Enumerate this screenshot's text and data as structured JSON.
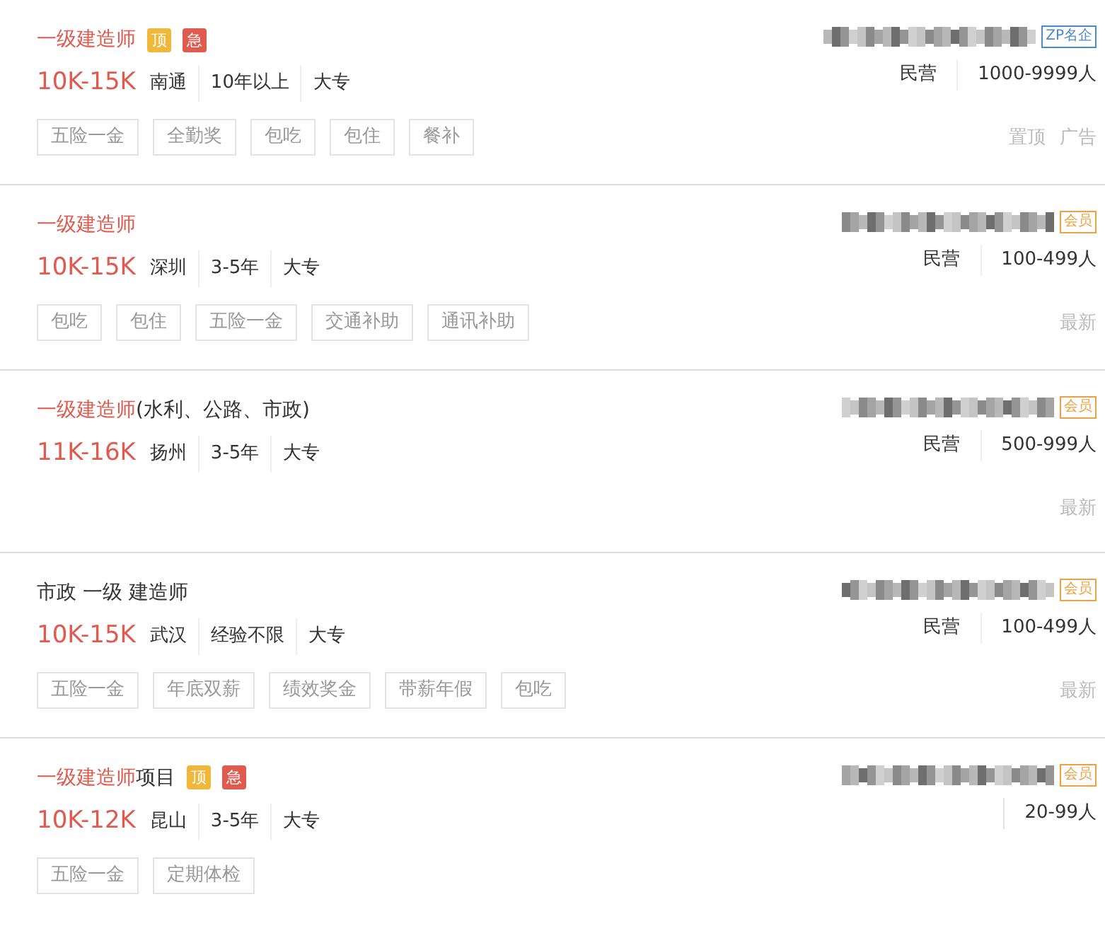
{
  "jobs": [
    {
      "title": [
        {
          "text": "一级建造师",
          "highlight": true
        }
      ],
      "flags": [
        {
          "text": "顶",
          "kind": "top"
        },
        {
          "text": "急",
          "kind": "urgent"
        }
      ],
      "salary": "10K-15K",
      "meta": [
        "南通",
        "10年以上",
        "大专"
      ],
      "tags": [
        "五险一金",
        "全勤奖",
        "包吃",
        "包住",
        "餐补"
      ],
      "company": {
        "blurred": true,
        "badge": {
          "text": "ZP名企",
          "color": "#4a8bd0"
        },
        "type": "民营",
        "size": "1000-9999人"
      },
      "labels": [
        "置顶",
        "广告"
      ]
    },
    {
      "title": [
        {
          "text": "一级建造师",
          "highlight": true
        }
      ],
      "salary": "10K-15K",
      "meta": [
        "深圳",
        "3-5年",
        "大专"
      ],
      "tags": [
        "包吃",
        "包住",
        "五险一金",
        "交通补助",
        "通讯补助"
      ],
      "company": {
        "blurred": true,
        "badge": {
          "text": "会员",
          "color": "#f0a040"
        },
        "type": "民营",
        "size": "100-499人"
      },
      "labels": [
        "最新"
      ]
    },
    {
      "title": [
        {
          "text": "一级建造师",
          "highlight": true
        },
        {
          "text": "(水利、公路、市政)",
          "highlight": false
        }
      ],
      "salary": "11K-16K",
      "meta": [
        "扬州",
        "3-5年",
        "大专"
      ],
      "company": {
        "blurred": true,
        "badge": {
          "text": "会员",
          "color": "#f0a040"
        },
        "type": "民营",
        "size": "500-999人"
      },
      "labels": [
        "最新"
      ]
    },
    {
      "title": [
        {
          "text": "市政 一级 建造师",
          "highlight": false
        }
      ],
      "salary": "10K-15K",
      "meta": [
        "武汉",
        "经验不限",
        "大专"
      ],
      "tags": [
        "五险一金",
        "年底双薪",
        "绩效奖金",
        "带薪年假",
        "包吃"
      ],
      "company": {
        "blurred": true,
        "badge": {
          "text": "会员",
          "color": "#f0a040"
        },
        "type": "民营",
        "size": "100-499人"
      },
      "labels": [
        "最新"
      ]
    },
    {
      "title": [
        {
          "text": "一级建造师",
          "highlight": true
        },
        {
          "text": "项目",
          "highlight": false
        }
      ],
      "flags": [
        {
          "text": "顶",
          "kind": "top"
        },
        {
          "text": "急",
          "kind": "urgent"
        }
      ],
      "salary": "10K-12K",
      "meta": [
        "昆山",
        "3-5年",
        "大专"
      ],
      "tags": [
        "五险一金",
        "定期体检"
      ],
      "company": {
        "blurred": true,
        "badge": {
          "text": "会员",
          "color": "#f0a040"
        },
        "size": "20-99人"
      }
    }
  ]
}
